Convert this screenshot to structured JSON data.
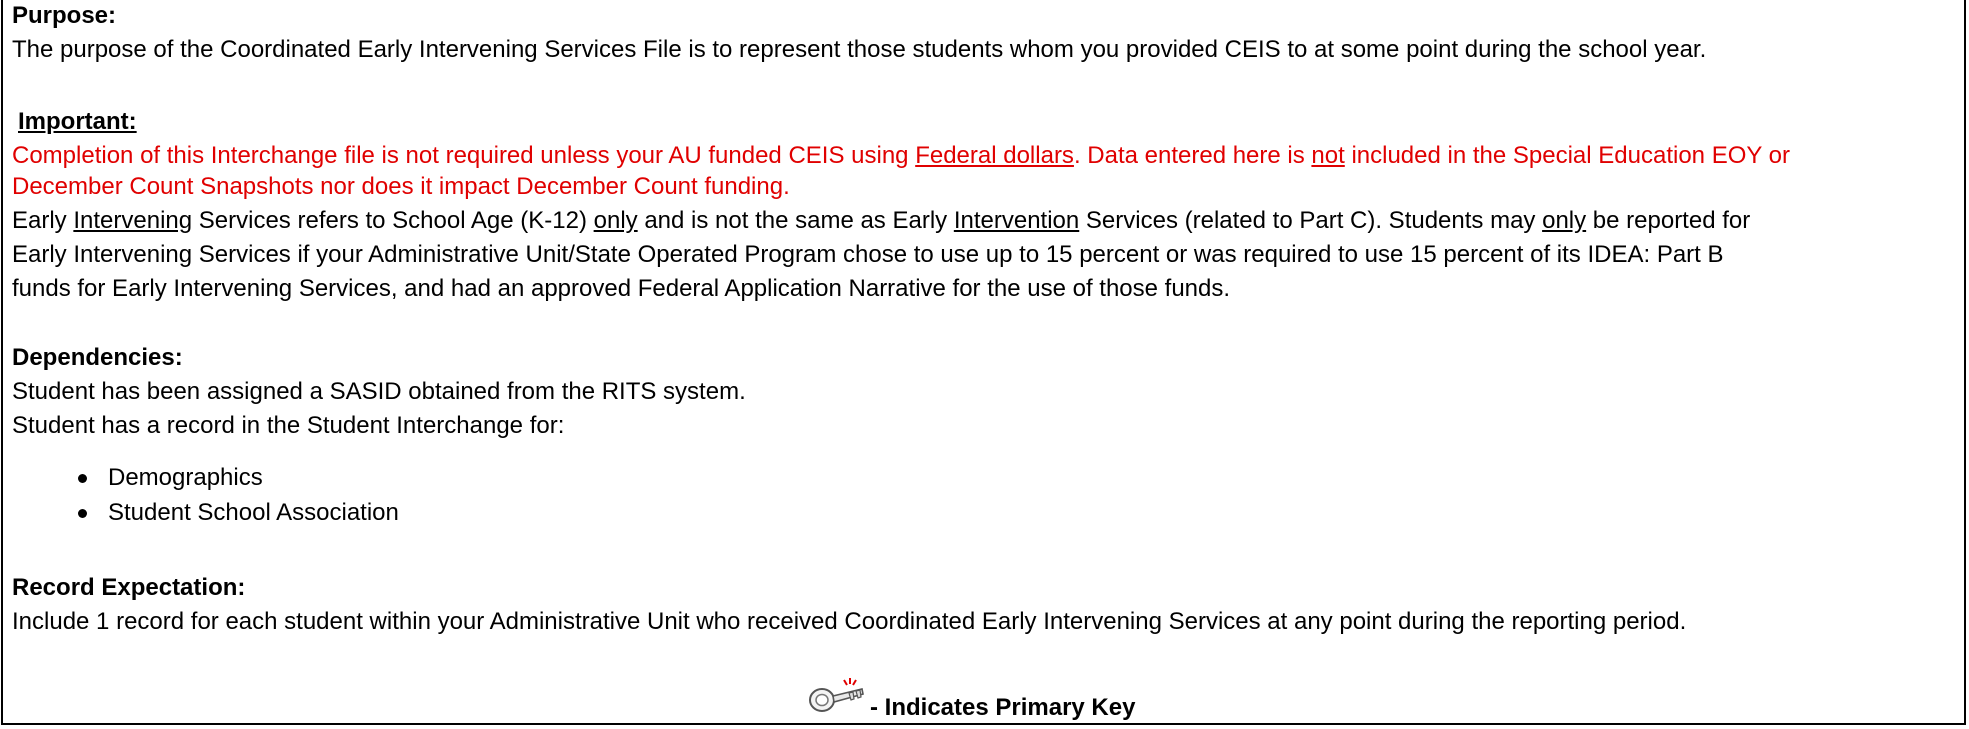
{
  "purpose": {
    "heading": "Purpose:",
    "text": "The purpose of the Coordinated Early Intervening Services File is to represent those students whom you provided CEIS to at some point during the school year."
  },
  "important": {
    "heading": "Important:",
    "red_line1_a": "Completion of this Interchange file is not required unless your AU funded CEIS using ",
    "red_line1_link": "Federal dollars",
    "red_line1_b": ". Data entered here is ",
    "red_line1_not": "not",
    "red_line1_c": " included in the Special Education EOY or",
    "red_line2": "December Count Snapshots nor does it impact December Count funding.",
    "p1_a": "Early ",
    "p1_intervening": "Intervening",
    "p1_b": " Services refers to School Age (K-12) ",
    "p1_only1": "only",
    "p1_c": " and is not the same as Early ",
    "p1_intervention": "Intervention",
    "p1_d": " Services (related to Part C). Students may ",
    "p1_only2": "only",
    "p1_e": " be reported for",
    "p2": "Early Intervening Services if your Administrative Unit/State Operated Program chose to use up to 15 percent or was required to use 15 percent of its IDEA: Part B",
    "p3": "funds for Early Intervening Services, and had an approved Federal Application Narrative for the use of those funds."
  },
  "dependencies": {
    "heading": "Dependencies:",
    "line1": "Student has been assigned a SASID obtained from the RITS system.",
    "line2": "Student has a record in the Student Interchange for:",
    "items": [
      "Demographics",
      "Student School Association"
    ]
  },
  "record_expectation": {
    "heading": "Record Expectation:",
    "text": "Include 1 record for each student within your Administrative Unit who received Coordinated Early Intervening Services at any point during the reporting period."
  },
  "legend": {
    "icon": "key-icon",
    "label": "- Indicates Primary Key"
  }
}
